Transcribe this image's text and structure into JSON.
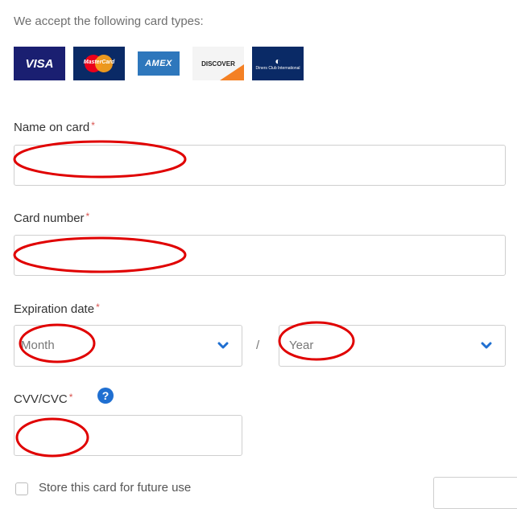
{
  "intro_text": "We accept the following card types:",
  "card_types": [
    {
      "name": "VISA",
      "color": "#1a1f71"
    },
    {
      "name": "MasterCard",
      "color": "#0a2a66"
    },
    {
      "name": "AMEX",
      "color": "#2e77bc"
    },
    {
      "name": "DISCOVER",
      "color": "#f4f4f4"
    },
    {
      "name": "Diners Club International",
      "color": "#0a2a66"
    }
  ],
  "form": {
    "name_label": "Name on card",
    "number_label": "Card number",
    "expiry_label": "Expiration date",
    "month_placeholder": "Month",
    "year_placeholder": "Year",
    "date_separator": "/",
    "cvv_label": "CVV/CVC",
    "required_mark": "*",
    "help_mark": "?",
    "store_label": "Store this card for future use"
  },
  "colors": {
    "accent": "#1f6fd1",
    "required": "#d9534f",
    "annotation": "#e00000"
  }
}
